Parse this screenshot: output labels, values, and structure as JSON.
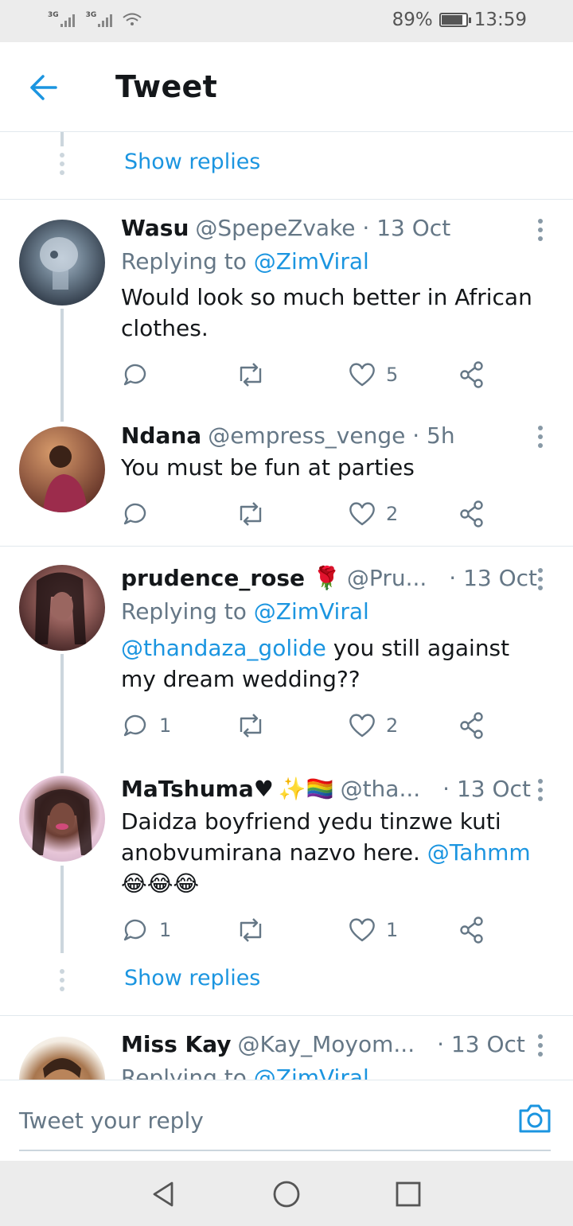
{
  "status_bar": {
    "network1": "3G",
    "network2": "3G",
    "battery_percent": "89%",
    "battery_level": 0.89,
    "time": "13:59"
  },
  "header": {
    "title": "Tweet"
  },
  "thread": {
    "show_replies_label": "Show replies"
  },
  "tweets": [
    {
      "name": "Wasu",
      "handle": "@SpepeZvake",
      "time": "13 Oct",
      "replying_prefix": "Replying to",
      "replying_to": "@ZimViral",
      "text": "Would look so much better in African clothes.",
      "replies": "",
      "likes": "5"
    },
    {
      "name": "Ndana",
      "handle": "@empress_venge",
      "time": "5h",
      "text": "You must be fun at parties",
      "replies": "",
      "likes": "2"
    },
    {
      "name": "prudence_rose",
      "emoji": "🌹",
      "handle": "@Pru...",
      "time": "13 Oct",
      "replying_prefix": "Replying to",
      "replying_to": "@ZimViral",
      "text_mention": "@thandaza_golide",
      "text": " you still against my dream wedding??",
      "replies": "1",
      "likes": "2"
    },
    {
      "name": "MaTshuma♥",
      "emoji": "✨🏳️‍🌈",
      "handle": "@tha...",
      "time": "13 Oct",
      "text": "Daidza boyfriend yedu tinzwe kuti anobvumirana nazvo here. ",
      "text_mention": "@Tahmm",
      "text_emoji": "😂😂😂",
      "replies": "1",
      "likes": "1"
    },
    {
      "name": "Miss Kay",
      "handle": "@Kay_Moyom...",
      "time": "13 Oct",
      "replying_prefix": "Replying to",
      "replying_to": "@ZimViral"
    }
  ],
  "composer": {
    "placeholder": "Tweet your reply"
  },
  "icons": {
    "back": "arrow-left-icon",
    "reply": "speech-bubble-icon",
    "retweet": "retweet-icon",
    "like": "heart-icon",
    "share": "share-icon",
    "camera": "camera-icon",
    "nav_back": "triangle-back-icon",
    "nav_home": "circle-home-icon",
    "nav_recents": "square-recents-icon"
  },
  "colors": {
    "accent": "#1b95e0",
    "text": "#14171a",
    "secondary": "#657786",
    "thread_line": "#ccd6dd"
  }
}
